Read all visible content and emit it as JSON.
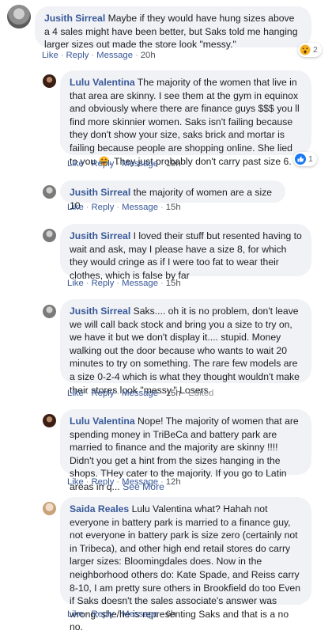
{
  "comments": [
    {
      "name": "Jusith Sirreal",
      "text": " Maybe if they would have hung sizes above a 4 sales might have been better, but Saks told me hanging larger sizes out made the store look \"messy.\"",
      "like": "Like",
      "reply": "Reply",
      "message": "Message",
      "time": "20h",
      "reaction_count": "2",
      "reaction_icon": "wow-emoji-icon"
    },
    {
      "name": "Lulu Valentina",
      "text": " The majority of the women that live in that area are skinny. I see them at the gym in equinox and obviously where there are finance guys $$$ you ll find more skinnier women. Saks isn't failing because they don't show your size, saks brick and mortar is failing because people are shopping online. She lied to you",
      "text2": ". They just probably don't carry past size 6.",
      "like": "Like",
      "reply": "Reply",
      "message": "Message",
      "time": "19h",
      "reaction_count": "1",
      "reaction_icon": "thumbs-up-icon"
    },
    {
      "name": "Jusith Sirreal",
      "text": " the majority of women are a size 10",
      "like": "Like",
      "reply": "Reply",
      "message": "Message",
      "time": "15h"
    },
    {
      "name": "Jusith Sirreal",
      "text": " I loved their stuff but resented having to wait and ask, may I please have a size 8, for which they would cringe as if I were too fat to wear their clothes, which is false by far",
      "like": "Like",
      "reply": "Reply",
      "message": "Message",
      "time": "15h"
    },
    {
      "name": "Jusith Sirreal",
      "text": " Saks.... oh it is no problem, don't leave we will call back stock and bring you a size to try on, we have it but we don't display it.... stupid. Money walking out the door because who wants to wait 20 minutes to try on something. The rare few models are a size 0-2-4 which is what they thought wouldn't make their stores look \"messy.\" Losers.",
      "like": "Like",
      "reply": "Reply",
      "message": "Message",
      "time": "15h",
      "edited": "Edited"
    },
    {
      "name": "Lulu Valentina",
      "text": " Nope! The majority of women that are spending money in TriBeCa and battery park are married to finance and the majority are skinny !!!! Didn't you get a hint from the sizes hanging in the shops. THey cater to the majority. If you go to Latin areas in q...",
      "see_more": "See More",
      "like": "Like",
      "reply": "Reply",
      "message": "Message",
      "time": "12h"
    },
    {
      "name": "Saida Reales",
      "text": " Lulu Valentina what? Hahah not everyone in battery park is married to a finance guy, not everyone in battery park is size zero (certainly not in Tribeca), and other high end retail stores do carry larger sizes: Bloomingdales does. Now in the neighborhood others do: Kate Spade, and Reiss carry 8-10, I am pretty sure others in Brookfield do too Even if Saks doesn't the sales associate's answer was wrong: she/he is representing Saks and that is a no no.",
      "like": "Like",
      "reply": "Reply",
      "message": "Message",
      "time": "6h"
    }
  ]
}
